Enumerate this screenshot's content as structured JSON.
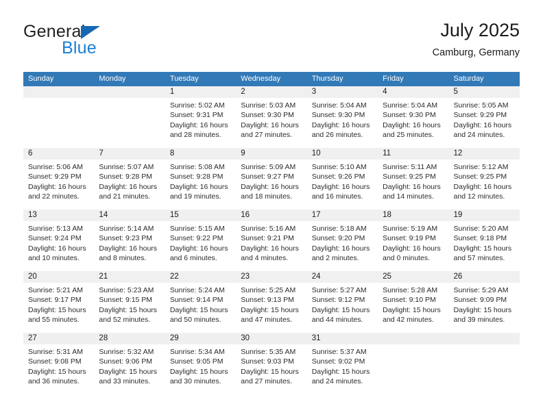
{
  "brand": {
    "name_part1": "General",
    "name_part2": "Blue",
    "triangle_color": "#1668b3",
    "blue_color": "#1a7fd4"
  },
  "header": {
    "title": "July 2025",
    "subtitle": "Camburg, Germany"
  },
  "colors": {
    "header_blue": "#3279b7",
    "row_divider": "#2f6ca8",
    "date_band": "#f0f0f0"
  },
  "weekdays": [
    "Sunday",
    "Monday",
    "Tuesday",
    "Wednesday",
    "Thursday",
    "Friday",
    "Saturday"
  ],
  "weeks": [
    [
      {
        "day": "",
        "lines": []
      },
      {
        "day": "",
        "lines": []
      },
      {
        "day": "1",
        "lines": [
          "Sunrise: 5:02 AM",
          "Sunset: 9:31 PM",
          "Daylight: 16 hours",
          "and 28 minutes."
        ]
      },
      {
        "day": "2",
        "lines": [
          "Sunrise: 5:03 AM",
          "Sunset: 9:30 PM",
          "Daylight: 16 hours",
          "and 27 minutes."
        ]
      },
      {
        "day": "3",
        "lines": [
          "Sunrise: 5:04 AM",
          "Sunset: 9:30 PM",
          "Daylight: 16 hours",
          "and 26 minutes."
        ]
      },
      {
        "day": "4",
        "lines": [
          "Sunrise: 5:04 AM",
          "Sunset: 9:30 PM",
          "Daylight: 16 hours",
          "and 25 minutes."
        ]
      },
      {
        "day": "5",
        "lines": [
          "Sunrise: 5:05 AM",
          "Sunset: 9:29 PM",
          "Daylight: 16 hours",
          "and 24 minutes."
        ]
      }
    ],
    [
      {
        "day": "6",
        "lines": [
          "Sunrise: 5:06 AM",
          "Sunset: 9:29 PM",
          "Daylight: 16 hours",
          "and 22 minutes."
        ]
      },
      {
        "day": "7",
        "lines": [
          "Sunrise: 5:07 AM",
          "Sunset: 9:28 PM",
          "Daylight: 16 hours",
          "and 21 minutes."
        ]
      },
      {
        "day": "8",
        "lines": [
          "Sunrise: 5:08 AM",
          "Sunset: 9:28 PM",
          "Daylight: 16 hours",
          "and 19 minutes."
        ]
      },
      {
        "day": "9",
        "lines": [
          "Sunrise: 5:09 AM",
          "Sunset: 9:27 PM",
          "Daylight: 16 hours",
          "and 18 minutes."
        ]
      },
      {
        "day": "10",
        "lines": [
          "Sunrise: 5:10 AM",
          "Sunset: 9:26 PM",
          "Daylight: 16 hours",
          "and 16 minutes."
        ]
      },
      {
        "day": "11",
        "lines": [
          "Sunrise: 5:11 AM",
          "Sunset: 9:25 PM",
          "Daylight: 16 hours",
          "and 14 minutes."
        ]
      },
      {
        "day": "12",
        "lines": [
          "Sunrise: 5:12 AM",
          "Sunset: 9:25 PM",
          "Daylight: 16 hours",
          "and 12 minutes."
        ]
      }
    ],
    [
      {
        "day": "13",
        "lines": [
          "Sunrise: 5:13 AM",
          "Sunset: 9:24 PM",
          "Daylight: 16 hours",
          "and 10 minutes."
        ]
      },
      {
        "day": "14",
        "lines": [
          "Sunrise: 5:14 AM",
          "Sunset: 9:23 PM",
          "Daylight: 16 hours",
          "and 8 minutes."
        ]
      },
      {
        "day": "15",
        "lines": [
          "Sunrise: 5:15 AM",
          "Sunset: 9:22 PM",
          "Daylight: 16 hours",
          "and 6 minutes."
        ]
      },
      {
        "day": "16",
        "lines": [
          "Sunrise: 5:16 AM",
          "Sunset: 9:21 PM",
          "Daylight: 16 hours",
          "and 4 minutes."
        ]
      },
      {
        "day": "17",
        "lines": [
          "Sunrise: 5:18 AM",
          "Sunset: 9:20 PM",
          "Daylight: 16 hours",
          "and 2 minutes."
        ]
      },
      {
        "day": "18",
        "lines": [
          "Sunrise: 5:19 AM",
          "Sunset: 9:19 PM",
          "Daylight: 16 hours",
          "and 0 minutes."
        ]
      },
      {
        "day": "19",
        "lines": [
          "Sunrise: 5:20 AM",
          "Sunset: 9:18 PM",
          "Daylight: 15 hours",
          "and 57 minutes."
        ]
      }
    ],
    [
      {
        "day": "20",
        "lines": [
          "Sunrise: 5:21 AM",
          "Sunset: 9:17 PM",
          "Daylight: 15 hours",
          "and 55 minutes."
        ]
      },
      {
        "day": "21",
        "lines": [
          "Sunrise: 5:23 AM",
          "Sunset: 9:15 PM",
          "Daylight: 15 hours",
          "and 52 minutes."
        ]
      },
      {
        "day": "22",
        "lines": [
          "Sunrise: 5:24 AM",
          "Sunset: 9:14 PM",
          "Daylight: 15 hours",
          "and 50 minutes."
        ]
      },
      {
        "day": "23",
        "lines": [
          "Sunrise: 5:25 AM",
          "Sunset: 9:13 PM",
          "Daylight: 15 hours",
          "and 47 minutes."
        ]
      },
      {
        "day": "24",
        "lines": [
          "Sunrise: 5:27 AM",
          "Sunset: 9:12 PM",
          "Daylight: 15 hours",
          "and 44 minutes."
        ]
      },
      {
        "day": "25",
        "lines": [
          "Sunrise: 5:28 AM",
          "Sunset: 9:10 PM",
          "Daylight: 15 hours",
          "and 42 minutes."
        ]
      },
      {
        "day": "26",
        "lines": [
          "Sunrise: 5:29 AM",
          "Sunset: 9:09 PM",
          "Daylight: 15 hours",
          "and 39 minutes."
        ]
      }
    ],
    [
      {
        "day": "27",
        "lines": [
          "Sunrise: 5:31 AM",
          "Sunset: 9:08 PM",
          "Daylight: 15 hours",
          "and 36 minutes."
        ]
      },
      {
        "day": "28",
        "lines": [
          "Sunrise: 5:32 AM",
          "Sunset: 9:06 PM",
          "Daylight: 15 hours",
          "and 33 minutes."
        ]
      },
      {
        "day": "29",
        "lines": [
          "Sunrise: 5:34 AM",
          "Sunset: 9:05 PM",
          "Daylight: 15 hours",
          "and 30 minutes."
        ]
      },
      {
        "day": "30",
        "lines": [
          "Sunrise: 5:35 AM",
          "Sunset: 9:03 PM",
          "Daylight: 15 hours",
          "and 27 minutes."
        ]
      },
      {
        "day": "31",
        "lines": [
          "Sunrise: 5:37 AM",
          "Sunset: 9:02 PM",
          "Daylight: 15 hours",
          "and 24 minutes."
        ]
      },
      {
        "day": "",
        "lines": []
      },
      {
        "day": "",
        "lines": []
      }
    ]
  ]
}
